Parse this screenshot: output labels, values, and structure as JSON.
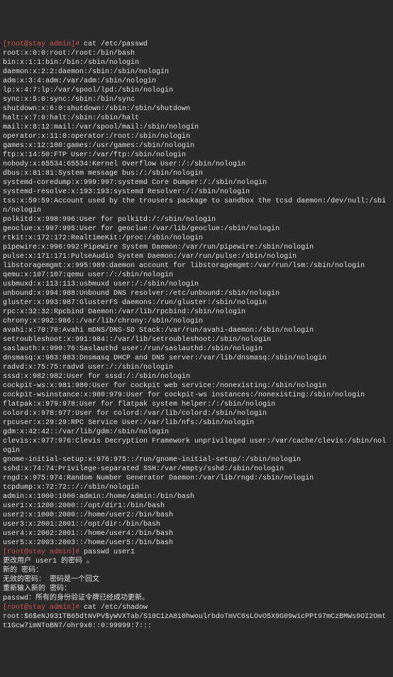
{
  "terminal": {
    "prompt1": "[root@stay admin]# ",
    "cmd1": "cat /etc/passwd",
    "passwd_lines": [
      "root:x:0:0:root:/root:/bin/bash",
      "bin:x:1:1:bin:/bin:/sbin/nologin",
      "daemon:x:2:2:daemon:/sbin:/sbin/nologin",
      "adm:x:3:4:adm:/var/adm:/sbin/nologin",
      "lp:x:4:7:lp:/var/spool/lpd:/sbin/nologin",
      "sync:x:5:0:sync:/sbin:/bin/sync",
      "shutdown:x:6:0:shutdown:/sbin:/sbin/shutdown",
      "halt:x:7:0:halt:/sbin:/sbin/halt",
      "mail:x:8:12:mail:/var/spool/mail:/sbin/nologin",
      "operator:x:11:0:operator:/root:/sbin/nologin",
      "games:x:12:100:games:/usr/games:/sbin/nologin",
      "ftp:x:14:50:FTP User:/var/ftp:/sbin/nologin",
      "nobody:x:65534:65534:Kernel Overflow User:/:/sbin/nologin",
      "dbus:x:81:81:System message bus:/:/sbin/nologin",
      "systemd-coredump:x:999:997:systemd Core Dumper:/:/sbin/nologin",
      "systemd-resolve:x:193:193:systemd Resolver:/:/sbin/nologin",
      "tss:x:59:59:Account used by the trousers package to sandbox the tcsd daemon:/dev/null:/sbin/nologin",
      "polkitd:x:998:996:User for polkitd:/:/sbin/nologin",
      "geoclue:x:997:995:User for geoclue:/var/lib/geoclue:/sbin/nologin",
      "rtkit:x:172:172:RealtimeKit:/proc:/sbin/nologin",
      "pipewire:x:996:992:PipeWire System Daemon:/var/run/pipewire:/sbin/nologin",
      "pulse:x:171:171:PulseAudio System Daemon:/var/run/pulse:/sbin/nologin",
      "libstoragemgmt:x:995:989:daemon account for libstoragemgmt:/var/run/lsm:/sbin/nologin",
      "qemu:x:107:107:qemu user:/:/sbin/nologin",
      "usbmuxd:x:113:113:usbmuxd user:/:/sbin/nologin",
      "unbound:x:994:988:Unbound DNS resolver:/etc/unbound:/sbin/nologin",
      "gluster:x:993:987:GlusterFS daemons:/run/gluster:/sbin/nologin",
      "rpc:x:32:32:Rpcbind Daemon:/var/lib/rpcbind:/sbin/nologin",
      "chrony:x:992:986::/var/lib/chrony:/sbin/nologin",
      "avahi:x:70:70:Avahi mDNS/DNS-SD Stack:/var/run/avahi-daemon:/sbin/nologin",
      "setroubleshoot:x:991:984::/var/lib/setroubleshoot:/sbin/nologin",
      "saslauth:x:990:76:Saslauthd user:/run/saslauthd:/sbin/nologin",
      "dnsmasq:x:983:983:Dnsmasq DHCP and DNS server:/var/lib/dnsmasq:/sbin/nologin",
      "radvd:x:75:75:radvd user:/:/sbin/nologin",
      "sssd:x:982:982:User for sssd:/:/sbin/nologin",
      "cockpit-ws:x:981:980:User for cockpit web service:/nonexisting:/sbin/nologin",
      "cockpit-wsinstance:x:980:979:User for cockpit-ws instances:/nonexisting:/sbin/nologin",
      "flatpak:x:979:978:User for flatpak system helper:/:/sbin/nologin",
      "colord:x:978:977:User for colord:/var/lib/colord:/sbin/nologin",
      "rpcuser:x:29:29:RPC Service User:/var/lib/nfs:/sbin/nologin",
      "gdm:x:42:42::/var/lib/gdm:/sbin/nologin",
      "clevis:x:977:976:Clevis Decryption Framework unprivileged user:/var/cache/clevis:/sbin/nologin",
      "gnome-initial-setup:x:976:975::/run/gnome-initial-setup/:/sbin/nologin",
      "sshd:x:74:74:Privilege-separated SSH:/var/empty/sshd:/sbin/nologin",
      "rngd:x:975:974:Random Number Generator Daemon:/var/lib/rngd:/sbin/nologin",
      "tcpdump:x:72:72::/:/sbin/nologin",
      "admin:x:1000:1000:admin:/home/admin:/bin/bash",
      "user1:x:1200:2000::/opt/dir1:/bin/bash",
      "user2:x:1000:2000::/home/user2:/bin/bash",
      "user3:x:2001:2001::/opt/dir:/bin/bash",
      "user4:x:2002:2001::/home/user4:/bin/bash",
      "user5:x:2003:2003::/home/user5:/bin/bash"
    ],
    "prompt2": "[root@stay admin]# ",
    "cmd2": "passwd user1",
    "pw_lines": [
      "更改用户 user1 的密码 。",
      "新的 密码：",
      "无效的密码： 密码是一个回文",
      "重新输入新的 密码：",
      "passwd：所有的身份验证令牌已经成功更新。"
    ],
    "prompt3": "[root@stay admin]# ",
    "cmd3": "cat /etc/shadow",
    "shadow_line": "root:$6$eNJ931TB65dtNVPV$yWVXTab/S10C1zA8i0hwoulrbdoTmVC6sLOvO5X9G09w1cPPt97mCzBMWs9OI2Omtt1Gcw7imNToBN7/ohr9x0::0:99999:7:::"
  }
}
